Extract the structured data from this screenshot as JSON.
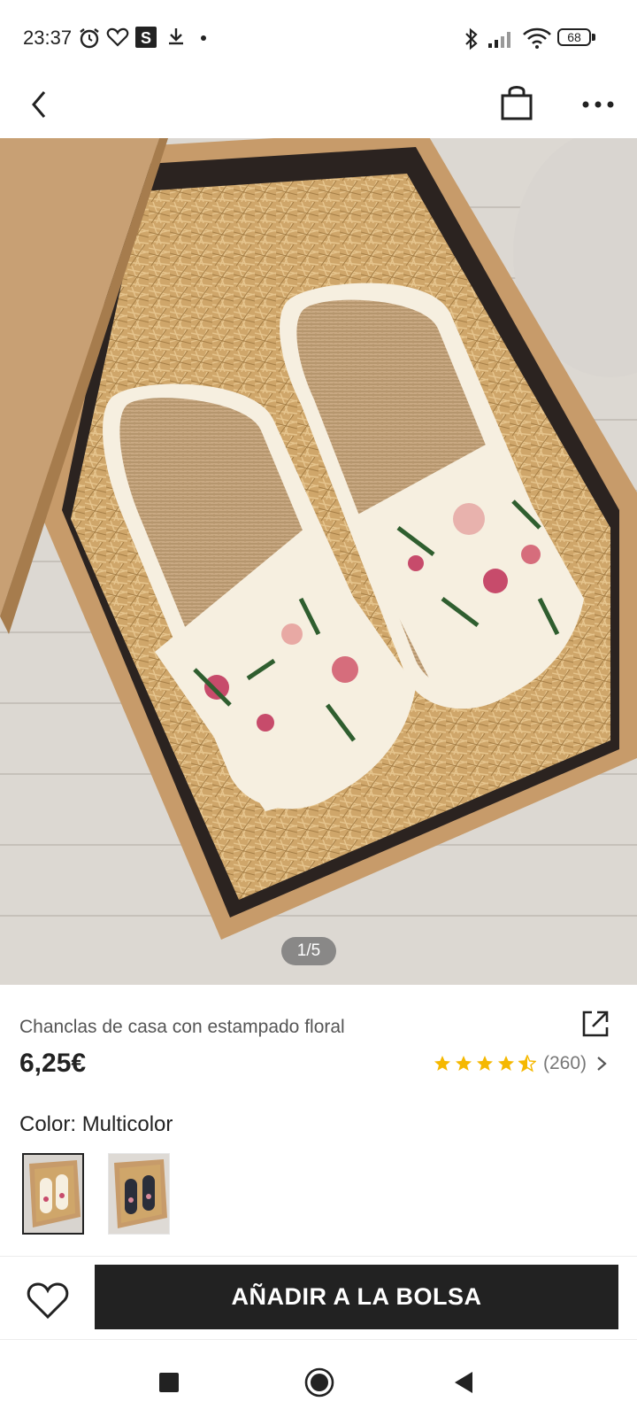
{
  "status_bar": {
    "time": "23:37",
    "battery": "68",
    "icons": [
      "alarm-icon",
      "heart-icon",
      "s-app-icon",
      "download-icon",
      "dot-icon",
      "bluetooth-icon",
      "signal-icon",
      "wifi-icon",
      "battery-icon"
    ]
  },
  "top_bar": {
    "icons": [
      "back-arrow-icon",
      "shopping-bag-icon",
      "more-icon"
    ]
  },
  "gallery": {
    "counter": "1/5",
    "description_colors": {
      "floral_pink": "#c74b6b",
      "leaf_green": "#2f5e2f",
      "fabric_cream": "#f6efe0"
    }
  },
  "product": {
    "title": "Chanclas de casa con estampado floral",
    "price": "6,25€",
    "rating_stars": 4.5,
    "rating_count": "(260)",
    "share_icon": "share-icon",
    "star_color": "#f5b800"
  },
  "color_selector": {
    "label": "Color: Multicolor",
    "options": [
      "multicolor-beige",
      "multicolor-dark"
    ],
    "selected_index": 0
  },
  "bottom_bar": {
    "add_to_bag_label": "AÑADIR A LA BOLSA",
    "wishlist_icon": "heart-outline-icon"
  },
  "nav_bar": {
    "icons": [
      "square-icon",
      "circle-icon",
      "triangle-back-icon"
    ]
  }
}
